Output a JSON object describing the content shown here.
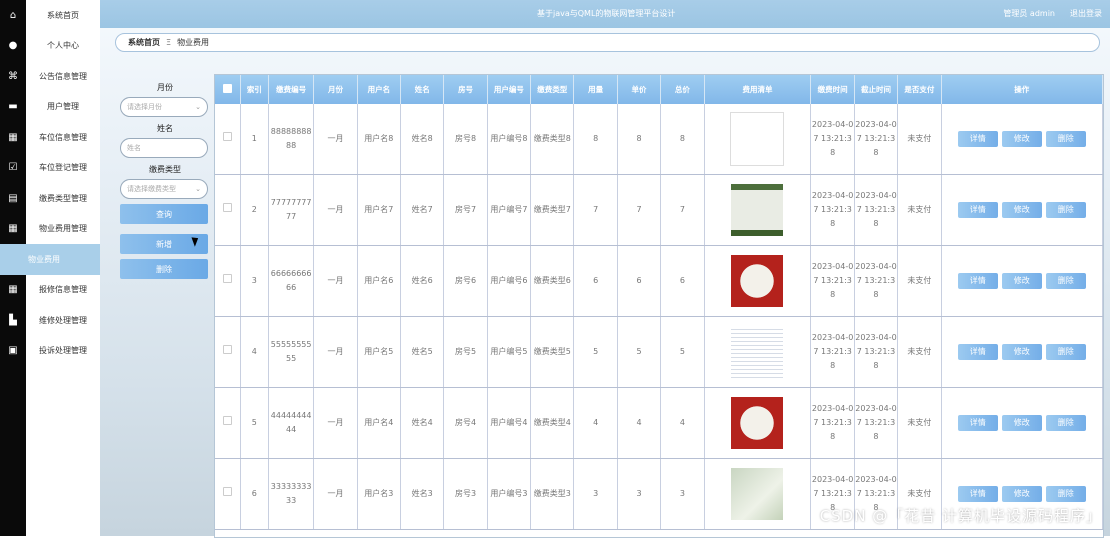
{
  "header": {
    "title": "基于java与QML的物联网管理平台设计",
    "admin": "管理员 admin",
    "logout": "退出登录"
  },
  "sidebar": {
    "items": [
      {
        "label": "系统首页",
        "icon": "home-icon"
      },
      {
        "label": "个人中心",
        "icon": "user-icon"
      },
      {
        "label": "公告信息管理",
        "icon": "bow-icon"
      },
      {
        "label": "用户管理",
        "icon": "monitor-icon"
      },
      {
        "label": "车位信息管理",
        "icon": "grid-icon"
      },
      {
        "label": "车位登记管理",
        "icon": "checkbox-icon"
      },
      {
        "label": "缴费类型管理",
        "icon": "clipboard-icon"
      },
      {
        "label": "物业费用管理",
        "icon": "grid-icon"
      },
      {
        "label": "物业费用",
        "icon": "",
        "active": true
      },
      {
        "label": "报修信息管理",
        "icon": "table-icon"
      },
      {
        "label": "维修处理管理",
        "icon": "car-icon"
      },
      {
        "label": "投诉处理管理",
        "icon": "printer-icon"
      }
    ]
  },
  "breadcrumb": {
    "home": "系统首页",
    "sep": "Ξ",
    "current": "物业费用"
  },
  "search": {
    "month_label": "月份",
    "month_placeholder": "请选择月份",
    "name_label": "姓名",
    "name_placeholder": "姓名",
    "type_label": "缴费类型",
    "type_placeholder": "请选择缴费类型",
    "query": "查询",
    "add": "新增",
    "delete": "删除"
  },
  "table": {
    "headers": [
      "索引",
      "缴费编号",
      "月份",
      "用户名",
      "姓名",
      "房号",
      "用户编号",
      "缴费类型",
      "用量",
      "单价",
      "总价",
      "费用清单",
      "缴费时间",
      "截止时间",
      "是否支付",
      "操作"
    ],
    "ops": {
      "detail": "详情",
      "edit": "修改",
      "delete": "删除"
    },
    "rows": [
      {
        "idx": "1",
        "code": "8888888888",
        "month": "一月",
        "username": "用户名8",
        "name": "姓名8",
        "room": "房号8",
        "userno": "用户编号8",
        "type": "缴费类型8",
        "usage": "8",
        "price": "8",
        "total": "8",
        "paytime": "2023-04-07 13:21:38",
        "deadline": "2023-04-07 13:21:38",
        "paid": "未支付",
        "thumb": "invoice"
      },
      {
        "idx": "2",
        "code": "7777777777",
        "month": "一月",
        "username": "用户名7",
        "name": "姓名7",
        "room": "房号7",
        "userno": "用户编号7",
        "type": "缴费类型7",
        "usage": "7",
        "price": "7",
        "total": "7",
        "paytime": "2023-04-07 13:21:38",
        "deadline": "2023-04-07 13:21:38",
        "paid": "未支付",
        "thumb": "green"
      },
      {
        "idx": "3",
        "code": "6666666666",
        "month": "一月",
        "username": "用户名6",
        "name": "姓名6",
        "room": "房号6",
        "userno": "用户编号6",
        "type": "缴费类型6",
        "usage": "6",
        "price": "6",
        "total": "6",
        "paytime": "2023-04-07 13:21:38",
        "deadline": "2023-04-07 13:21:38",
        "paid": "未支付",
        "thumb": "red"
      },
      {
        "idx": "4",
        "code": "5555555555",
        "month": "一月",
        "username": "用户名5",
        "name": "姓名5",
        "room": "房号5",
        "userno": "用户编号5",
        "type": "缴费类型5",
        "usage": "5",
        "price": "5",
        "total": "5",
        "paytime": "2023-04-07 13:21:38",
        "deadline": "2023-04-07 13:21:38",
        "paid": "未支付",
        "thumb": "sheet"
      },
      {
        "idx": "5",
        "code": "4444444444",
        "month": "一月",
        "username": "用户名4",
        "name": "姓名4",
        "room": "房号4",
        "userno": "用户编号4",
        "type": "缴费类型4",
        "usage": "4",
        "price": "4",
        "total": "4",
        "paytime": "2023-04-07 13:21:38",
        "deadline": "2023-04-07 13:21:38",
        "paid": "未支付",
        "thumb": "red"
      },
      {
        "idx": "6",
        "code": "3333333333",
        "month": "一月",
        "username": "用户名3",
        "name": "姓名3",
        "room": "房号3",
        "userno": "用户编号3",
        "type": "缴费类型3",
        "usage": "3",
        "price": "3",
        "total": "3",
        "paytime": "2023-04-07 13:21:38",
        "deadline": "2023-04-07 13:21:38",
        "paid": "未支付",
        "thumb": "paper"
      }
    ]
  },
  "watermark": "CSDN @「花昔 计算机毕设源码程序」"
}
